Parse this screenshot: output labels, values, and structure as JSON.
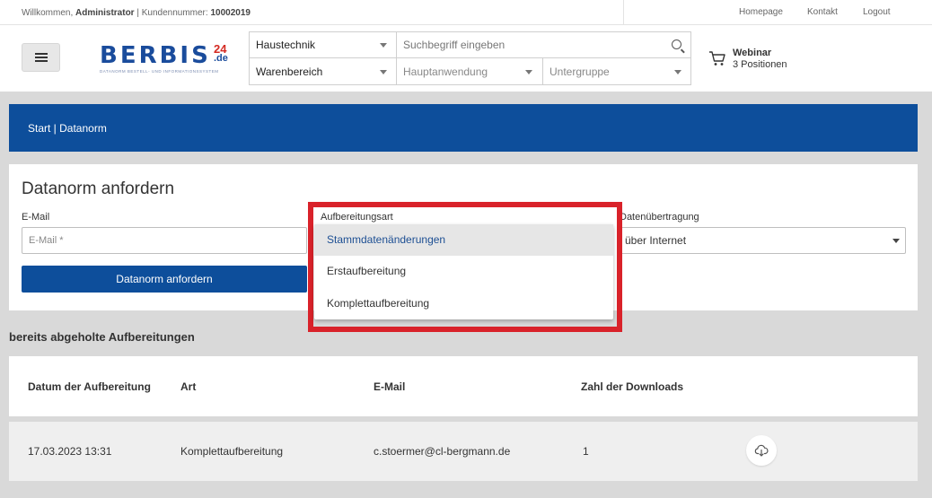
{
  "topbar": {
    "welcome_prefix": "Willkommen,",
    "user": "Administrator",
    "customer_label": "| Kundennummer:",
    "customer_number": "10002019",
    "links": [
      "Homepage",
      "Kontakt",
      "Logout"
    ]
  },
  "header": {
    "logo": {
      "word": "BERBIS",
      "number": "24",
      "domain": ".de",
      "tagline": "DATANORM BESTELL- UND INFORMATIONSSYSTEM"
    },
    "search": {
      "category": "Haustechnik",
      "placeholder": "Suchbegriff eingeben",
      "filter1": "Warenbereich",
      "filter2": "Hauptanwendung",
      "filter3": "Untergruppe"
    },
    "cart": {
      "title": "Webinar",
      "count_text": "3 Positionen"
    }
  },
  "breadcrumb": "Start | Datanorm",
  "form": {
    "title": "Datanorm anfordern",
    "email_label": "E-Mail",
    "email_placeholder": "E-Mail *",
    "type_label": "Aufbereitungsart",
    "transfer_label": "Datenübertragung",
    "transfer_value": "über Internet",
    "submit_label": "Datanorm anfordern"
  },
  "dropdown": {
    "options": [
      "Stammdatenänderungen",
      "Erstaufbereitung",
      "Komplettaufbereitung"
    ],
    "selected_index": 0
  },
  "history": {
    "title": "bereits abgeholte Aufbereitungen",
    "columns": [
      "Datum der Aufbereitung",
      "Art",
      "E-Mail",
      "Zahl der Downloads"
    ],
    "rows": [
      {
        "date": "17.03.2023 13:31",
        "type": "Komplettaufbereitung",
        "email": "c.stoermer@cl-bergmann.de",
        "downloads": "1"
      }
    ]
  },
  "colors": {
    "brand_blue": "#0d4e9b",
    "highlight_red": "#d9222a",
    "logo_red": "#d42a22"
  }
}
